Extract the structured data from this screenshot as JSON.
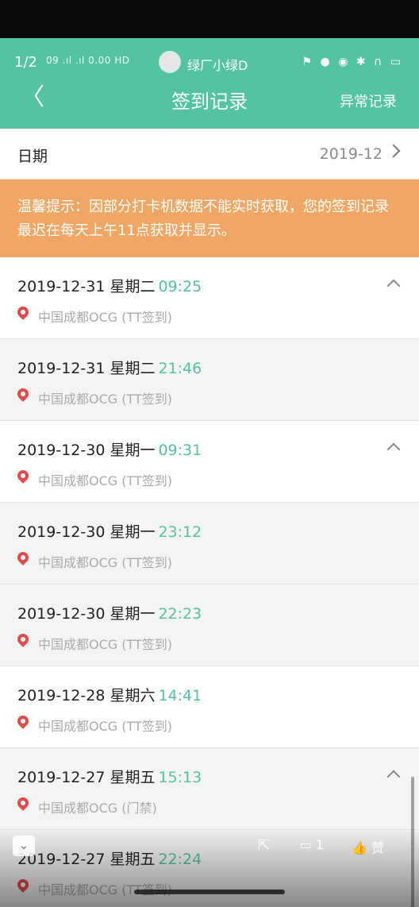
{
  "status_bar": {
    "counter": "1/2",
    "signal_text": "09 .ıl .ıl 0.00 HD",
    "username": "绿厂小绿D",
    "icons_text": "⚑ ● ◉ ✱ ∩ ▭"
  },
  "header": {
    "back_label": "〈",
    "title": "签到记录",
    "abnormal_label": "异常记录"
  },
  "date_filter": {
    "label": "日期",
    "value": "2019-12"
  },
  "notice": {
    "text": "温馨提示：因部分打卡机数据不能实时获取，您的签到记录最迟在每天上午11点获取并显示。"
  },
  "records": [
    {
      "date": "2019-12-31 星期二",
      "time": "09:25",
      "location": "中国成都OCG (TT签到)",
      "alt": false,
      "caret": true
    },
    {
      "date": "2019-12-31 星期二",
      "time": "21:46",
      "location": "中国成都OCG (TT签到)",
      "alt": true,
      "caret": false
    },
    {
      "date": "2019-12-30 星期一",
      "time": "09:31",
      "location": "中国成都OCG (TT签到)",
      "alt": false,
      "caret": true
    },
    {
      "date": "2019-12-30 星期一",
      "time": "23:12",
      "location": "中国成都OCG (TT签到)",
      "alt": true,
      "caret": false
    },
    {
      "date": "2019-12-30 星期一",
      "time": "22:23",
      "location": "中国成都OCG (TT签到)",
      "alt": true,
      "caret": false
    },
    {
      "date": "2019-12-28 星期六",
      "time": "14:41",
      "location": "中国成都OCG (TT签到)",
      "alt": false,
      "caret": false
    },
    {
      "date": "2019-12-27 星期五",
      "time": "15:13",
      "location": "中国成都OCG (门禁)",
      "alt": true,
      "caret": true
    },
    {
      "date": "2019-12-27 星期五",
      "time": "22:24",
      "location": "中国成都OCG (TT签到)",
      "alt": true,
      "caret": false
    }
  ],
  "bottom_bar": {
    "collapse_icon": "chevron-down-icon",
    "share_icon": "share-icon",
    "comment_count": "1",
    "like_label": "赞"
  },
  "colors": {
    "header_bg": "#53c3a2",
    "time_accent": "#53c3a2",
    "notice_bg": "#f0a765",
    "pin_red": "#e24b4b"
  }
}
